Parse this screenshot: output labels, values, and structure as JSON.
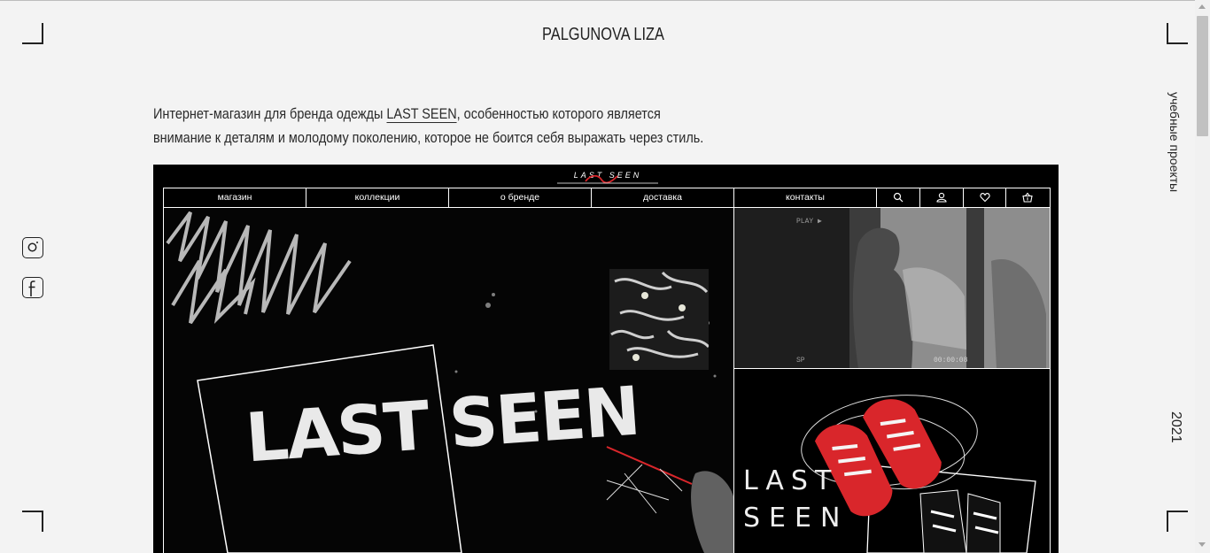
{
  "header": {
    "title": "PALGUNOVA LIZA"
  },
  "side": {
    "projects_label": "учебные проекты",
    "year": "2021"
  },
  "social": {
    "instagram": "instagram-icon",
    "facebook": "facebook-icon"
  },
  "description": {
    "line1_before": "Интернет-магазин для бренда одежды ",
    "brand_link": "LAST SEEN",
    "line1_after": ", особенностью которого является",
    "line2": "внимание к деталям и молодому поколению, которое не боится себя выражать через стиль."
  },
  "mockup": {
    "logo": "LAST SEEN",
    "nav": [
      "магазин",
      "коллекции",
      "о бренде",
      "доставка",
      "контакты"
    ],
    "nav_icons": [
      "search-icon",
      "user-icon",
      "heart-icon",
      "basket-icon"
    ],
    "hero_title": "LAST SEEN",
    "video": {
      "play": "PLAY ▶",
      "sp": "SP",
      "timecode": "00:00:08"
    },
    "products_text_1": "LAST",
    "products_text_2": "SEEN"
  },
  "colors": {
    "background": "#f3f3f3",
    "text": "#222222",
    "mockup_bg": "#000000",
    "accent_red": "#d9262b"
  }
}
